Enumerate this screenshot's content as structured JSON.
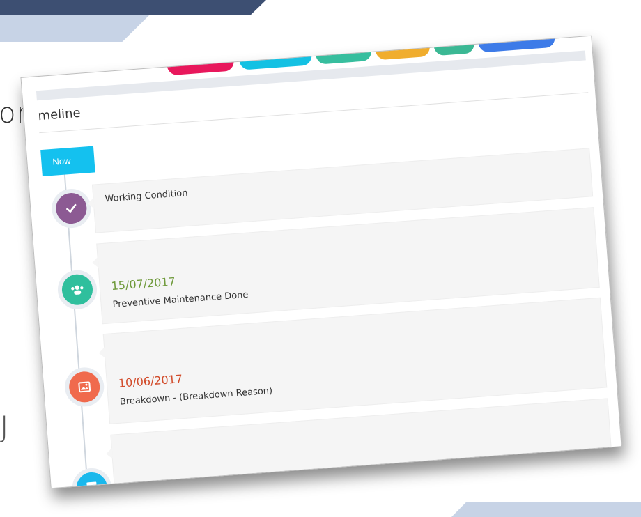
{
  "slide": {
    "fragment_right_word": "on",
    "fragment_bottom_glyph": "J"
  },
  "panel": {
    "title": "meline",
    "now_label": "Now",
    "top_tabs": [
      {
        "color": "#e8185c"
      },
      {
        "color": "#14c1e3"
      },
      {
        "color": "#37be9e"
      },
      {
        "color": "#f0ad2e"
      },
      {
        "color": "#3bb894"
      },
      {
        "color": "#3d7be8"
      }
    ],
    "events": [
      {
        "date": "",
        "date_color": "",
        "text": "Working Condition",
        "icon": "check-icon",
        "icon_color": "#8c5a93"
      },
      {
        "date": "15/07/2017",
        "date_color": "#6f9a3b",
        "text": "Preventive Maintenance Done",
        "icon": "users-icon",
        "icon_color": "#2fbf9d"
      },
      {
        "date": "10/06/2017",
        "date_color": "#d24c2b",
        "text": "Breakdown - (Breakdown Reason)",
        "icon": "image-icon",
        "icon_color": "#f06a4d"
      },
      {
        "date": "",
        "date_color": "",
        "text": "............",
        "icon": "database-icon",
        "icon_color": "#1ab8ec"
      }
    ]
  }
}
